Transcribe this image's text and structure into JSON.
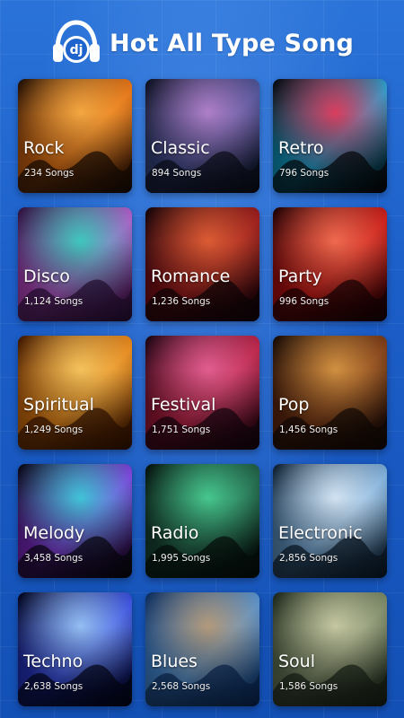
{
  "header": {
    "logo_text": "dj",
    "title": "Hot All Type Song"
  },
  "categories": [
    {
      "name": "Rock",
      "count": "234 Songs",
      "icon": "microphone-art",
      "colors": [
        "#1a0c04",
        "#e06a10",
        "#ffb54a"
      ]
    },
    {
      "name": "Classic",
      "count": "894 Songs",
      "icon": "turntable-art",
      "colors": [
        "#0b0e1c",
        "#3b4a8a",
        "#c58bd8"
      ]
    },
    {
      "name": "Retro",
      "count": "796 Songs",
      "icon": "speaker-equalizer-art",
      "colors": [
        "#050508",
        "#10b0e0",
        "#ff3050"
      ]
    },
    {
      "name": "Disco",
      "count": "1,124 Songs",
      "icon": "crowd-smoke-art",
      "colors": [
        "#2a0f3a",
        "#c24ac8",
        "#2ee0c0"
      ]
    },
    {
      "name": "Romance",
      "count": "1,236 Songs",
      "icon": "dj-booth-art",
      "colors": [
        "#100408",
        "#8a1018",
        "#f06a3a"
      ]
    },
    {
      "name": "Party",
      "count": "996 Songs",
      "icon": "party-crowd-art",
      "colors": [
        "#1a0204",
        "#c01010",
        "#ff7a5a"
      ]
    },
    {
      "name": "Spiritual",
      "count": "1,249 Songs",
      "icon": "trombone-player-art",
      "colors": [
        "#3a1400",
        "#e07a10",
        "#ffd36a"
      ]
    },
    {
      "name": "Festival",
      "count": "1,751 Songs",
      "icon": "festival-stage-art",
      "colors": [
        "#160410",
        "#b01a3a",
        "#f06aa0"
      ]
    },
    {
      "name": "Pop",
      "count": "1,456 Songs",
      "icon": "pop-music-art",
      "colors": [
        "#140a06",
        "#6a2a10",
        "#e8a44a"
      ]
    },
    {
      "name": "Melody",
      "count": "3,458 Songs",
      "icon": "rainbow-wave-art",
      "colors": [
        "#05060e",
        "#8a2ad8",
        "#3ae0e0"
      ]
    },
    {
      "name": "Radio",
      "count": "1,995 Songs",
      "icon": "mixer-board-art",
      "colors": [
        "#05100c",
        "#1a4a38",
        "#50e0a0"
      ]
    },
    {
      "name": "Electronic",
      "count": "2,856 Songs",
      "icon": "concert-crowd-art",
      "colors": [
        "#0a1a2a",
        "#6aa0d0",
        "#e8f4ff"
      ]
    },
    {
      "name": "Techno",
      "count": "2,638 Songs",
      "icon": "laser-show-art",
      "colors": [
        "#020418",
        "#2a3ad8",
        "#a8d8ff"
      ]
    },
    {
      "name": "Blues",
      "count": "2,568 Songs",
      "icon": "cart-riders-art",
      "colors": [
        "#0a2a5a",
        "#4a90d8",
        "#c8a070"
      ]
    },
    {
      "name": "Soul",
      "count": "1,586 Songs",
      "icon": "statue-art",
      "colors": [
        "#1a2418",
        "#6a7a5a",
        "#d8d8b0"
      ]
    }
  ]
}
